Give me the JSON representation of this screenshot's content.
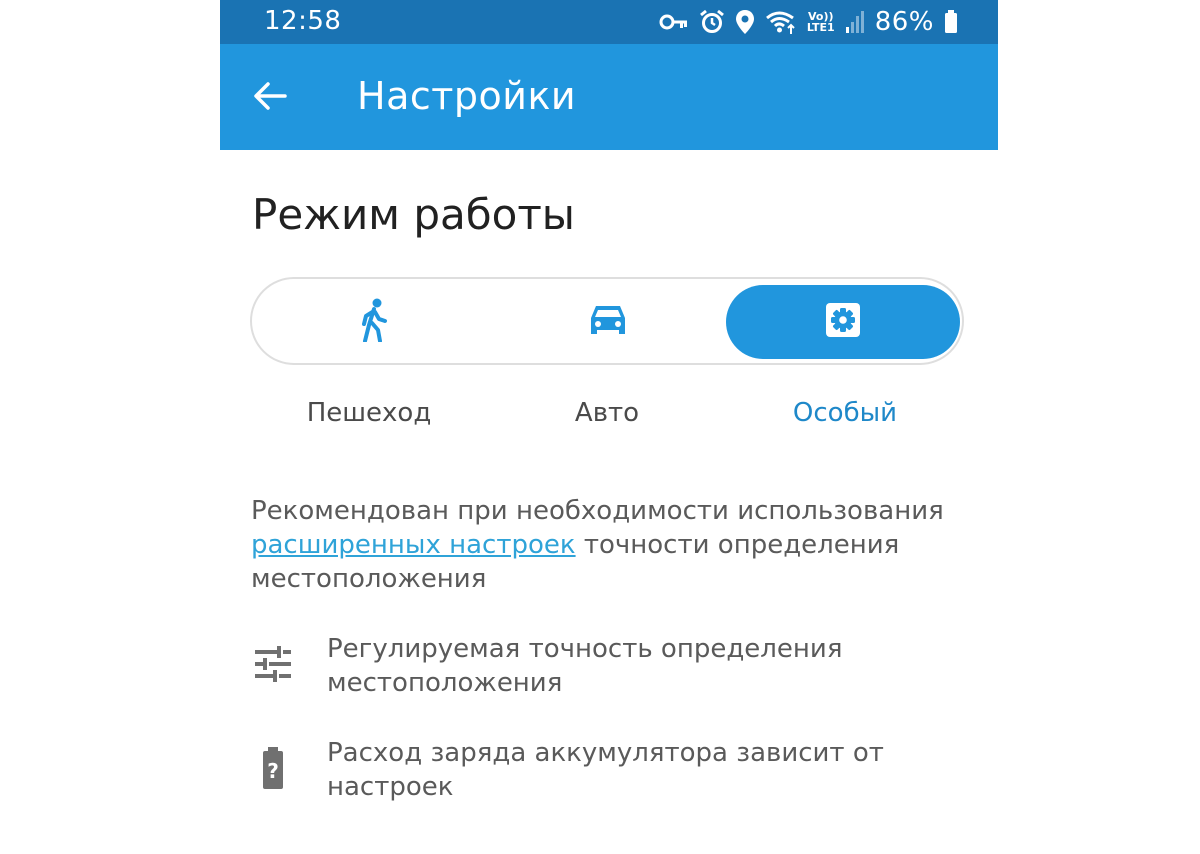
{
  "status_bar": {
    "time": "12:58",
    "volte_top": "Vo))",
    "volte_bottom": "LTE1",
    "battery_percent": "86%",
    "icons": [
      "key-icon",
      "alarm-icon",
      "location-icon",
      "wifi-icon",
      "volte-icon",
      "signal-icon",
      "battery-icon"
    ]
  },
  "app_bar": {
    "title": "Настройки",
    "back_icon": "arrow-back-icon"
  },
  "content": {
    "section_title": "Режим работы",
    "modes": [
      {
        "label": "Пешеход",
        "icon": "walk-icon",
        "selected": false
      },
      {
        "label": "Авто",
        "icon": "car-icon",
        "selected": false
      },
      {
        "label": "Особый",
        "icon": "settings-gear-icon",
        "selected": true
      }
    ],
    "description": {
      "before": "Рекомендован при необходимости использования ",
      "link": "расширенных настроек",
      "after": " точности определения местоположения"
    },
    "features": [
      {
        "icon": "tune-icon",
        "text": "Регулируемая точность определения местоположения"
      },
      {
        "icon": "battery-unknown-icon",
        "text": "Расход заряда аккумулятора зависит от настроек"
      }
    ]
  },
  "colors": {
    "status_bar": "#1a73b3",
    "app_bar": "#2196dd",
    "accent": "#2196dd",
    "selected_label": "#1e88c9",
    "link": "#2fa3d8",
    "icon_gray": "#707070"
  }
}
